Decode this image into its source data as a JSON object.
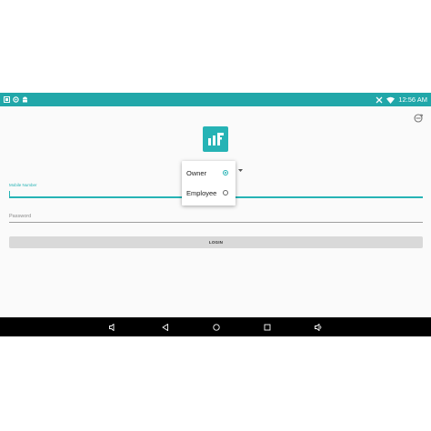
{
  "status_bar": {
    "time": "12:56 AM",
    "left_icons": [
      "notification-icon",
      "settings-icon",
      "android-icon"
    ],
    "right_icons": [
      "signal-icon",
      "wifi-icon"
    ],
    "color": "#21a7a9"
  },
  "app": {
    "logo_icon": "app-logo-icon",
    "corner_icon": "sync-icon"
  },
  "form": {
    "mobile_label": "Mobile Number",
    "password_placeholder": "Password",
    "login_label": "LOGIN"
  },
  "role_popup": {
    "options": [
      {
        "label": "Owner",
        "selected": true
      },
      {
        "label": "Employee",
        "selected": false
      }
    ]
  },
  "nav_bar": {
    "buttons": [
      "volume-down-icon",
      "back-icon",
      "home-icon",
      "recents-icon",
      "volume-up-icon"
    ]
  },
  "colors": {
    "accent": "#26b3b5",
    "nav_background": "#000000"
  }
}
